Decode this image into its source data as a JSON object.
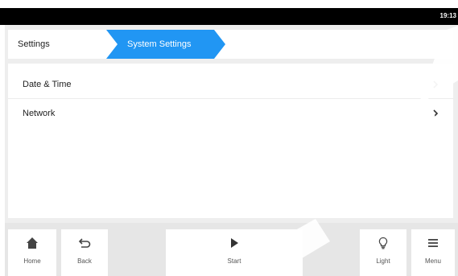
{
  "status_bar": {
    "time": "19:13"
  },
  "breadcrumb": {
    "items": [
      {
        "label": "Settings"
      },
      {
        "label": "System Settings",
        "active": true
      }
    ],
    "active_color": "#2196f3"
  },
  "settings_list": {
    "items": [
      {
        "label": "Date & Time",
        "icon": "chevron-right-icon"
      },
      {
        "label": "Network",
        "icon": "chevron-right-icon"
      }
    ]
  },
  "bottom_nav": {
    "home": {
      "label": "Home",
      "icon": "home-icon"
    },
    "back": {
      "label": "Back",
      "icon": "back-arrow-icon"
    },
    "start": {
      "label": "Start",
      "icon": "play-icon"
    },
    "light": {
      "label": "Light",
      "icon": "lightbulb-icon"
    },
    "menu": {
      "label": "Menu",
      "icon": "hamburger-menu-icon"
    }
  },
  "colors": {
    "status_bar": "#000000",
    "app_background": "#eeeeee",
    "accent": "#2196f3",
    "text": "#222222"
  }
}
